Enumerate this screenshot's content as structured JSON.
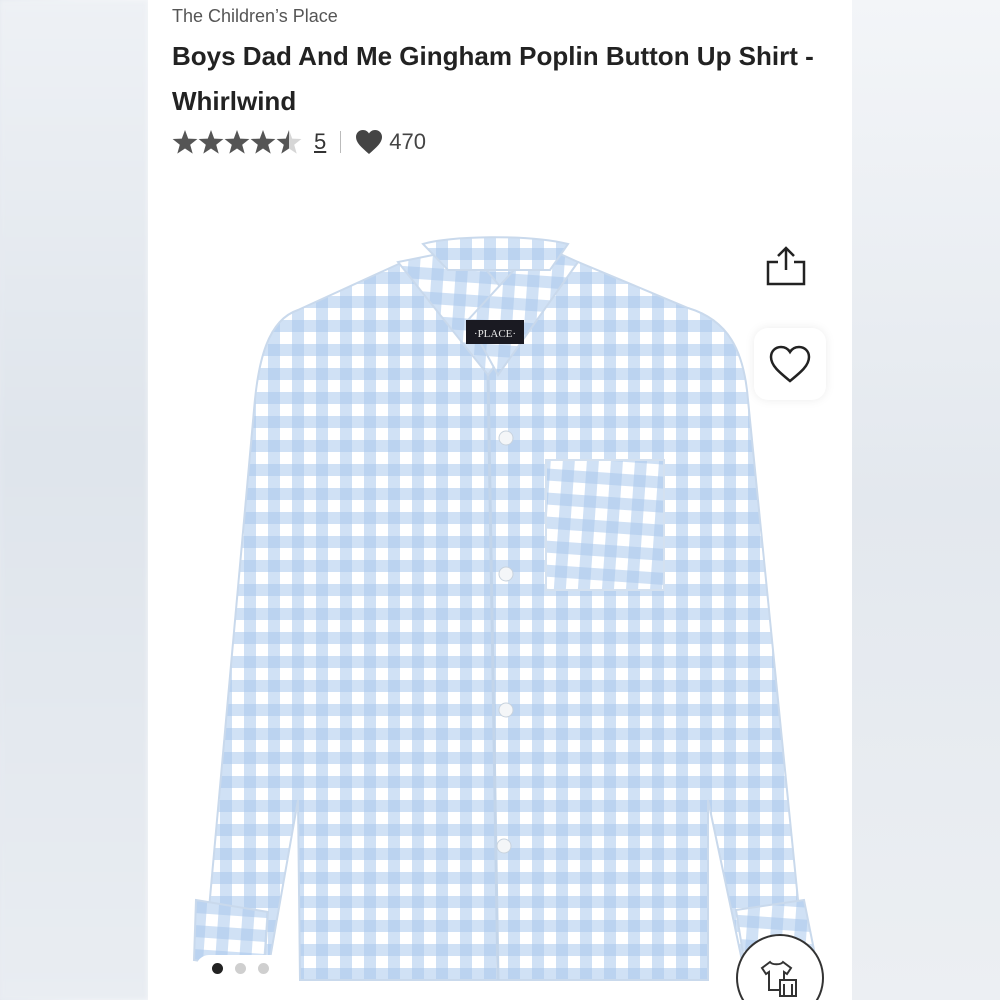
{
  "product": {
    "brand": "The Children’s Place",
    "title": "Boys Dad And Me Gingham Poplin Button Up Shirt - Whirlwind",
    "rating": 4.5,
    "rating_max": 5,
    "review_count": "5",
    "favorites_count": "470",
    "label_text": "·PLACE·"
  },
  "gallery": {
    "slide_count": 3,
    "active_slide": 1
  },
  "colors": {
    "gingham_blue": "#a9c8ec",
    "text_dark": "#222222",
    "star_fill": "#555555"
  },
  "icons": {
    "share": "share-icon",
    "favorite": "heart-outline-icon",
    "likes": "heart-filled-icon",
    "outfit": "outfit-icon"
  }
}
